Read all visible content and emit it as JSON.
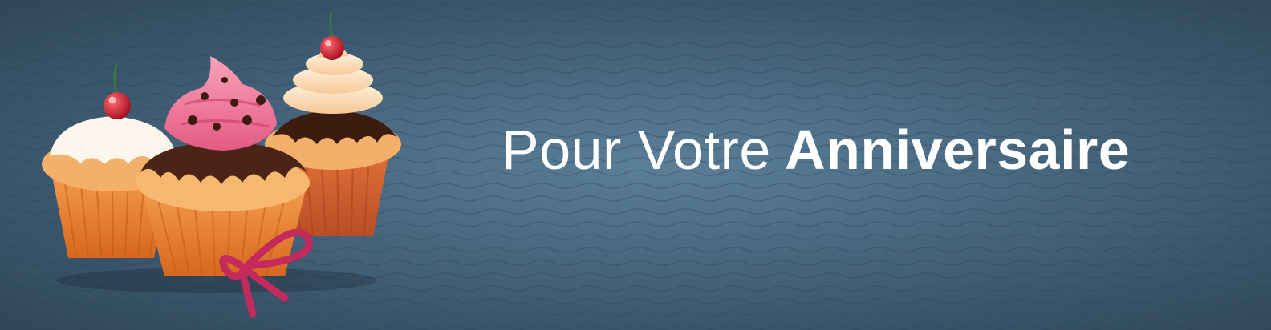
{
  "banner": {
    "headline_light": "Pour Votre",
    "headline_bold": "Anniversaire"
  },
  "colors": {
    "background": "#4a6b83",
    "text": "#ffffff",
    "frosting_pink": "#ef6f92",
    "frosting_cream": "#fbe2c2",
    "frosting_white": "#fdf6ec",
    "chocolate": "#4a2416",
    "paper_cup": "#e6782d",
    "cherry": "#c9182b",
    "ribbon": "#c42a5c"
  },
  "illustration": {
    "cupcakes": [
      "white-frosted-cupcake-with-cherry",
      "pink-frosted-cupcake-with-chocolate-chips",
      "cream-frosted-cupcake-with-cherry"
    ],
    "ribbon": "pink-bow-icon"
  }
}
